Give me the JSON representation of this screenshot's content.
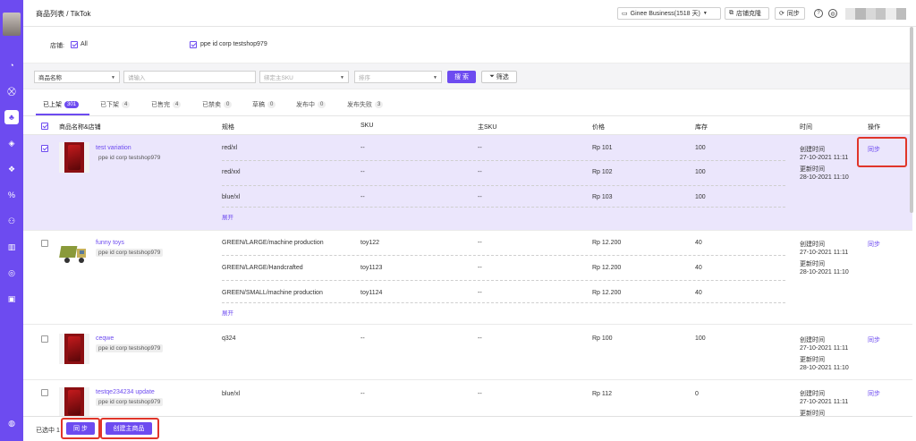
{
  "header": {
    "breadcrumb": "商品列表 / TikTok",
    "plan_label": "Ginee Business(1518 天)",
    "clone_label": "店铺克隆",
    "sync_label": "同步"
  },
  "shop_filter": {
    "label": "店铺:",
    "all_label": "All",
    "shop_name": "ppe id corp testshop979"
  },
  "search": {
    "field_select": "商品名称",
    "input_placeholder": "请输入",
    "bind_sku_placeholder": "绑定主SKU",
    "sort_placeholder": "排序",
    "search_button": "搜 索",
    "filter_button": "筛选"
  },
  "tabs": [
    {
      "label": "已上架",
      "count": "301"
    },
    {
      "label": "已下架",
      "count": "4"
    },
    {
      "label": "已售完",
      "count": "4"
    },
    {
      "label": "已禁卖",
      "count": "0"
    },
    {
      "label": "草稿",
      "count": "0"
    },
    {
      "label": "发布中",
      "count": "0"
    },
    {
      "label": "发布失败",
      "count": "3"
    }
  ],
  "table": {
    "headers": [
      "商品名称&店铺",
      "规格",
      "SKU",
      "主SKU",
      "价格",
      "库存",
      "时间",
      "操作"
    ],
    "expand_label": "展开",
    "sync_label": "同步",
    "created_label": "创建时间",
    "updated_label": "更新时间",
    "rows": [
      {
        "name": "test variation",
        "shop": "ppe id corp testshop979",
        "created": "27-10-2021 11:11",
        "updated": "28-10-2021 11:10",
        "variants": [
          {
            "spec": "red/xl",
            "sku": "--",
            "master_sku": "--",
            "price": "Rp 101",
            "stock": "100"
          },
          {
            "spec": "red/xxl",
            "sku": "--",
            "master_sku": "--",
            "price": "Rp 102",
            "stock": "100"
          },
          {
            "spec": "blue/xl",
            "sku": "--",
            "master_sku": "--",
            "price": "Rp 103",
            "stock": "100"
          }
        ]
      },
      {
        "name": "funny toys",
        "shop": "ppe id corp testshop979",
        "created": "27-10-2021 11:11",
        "updated": "28-10-2021 11:10",
        "variants": [
          {
            "spec": "GREEN/LARGE/machine production",
            "sku": "toy122",
            "master_sku": "--",
            "price": "Rp 12.200",
            "stock": "40"
          },
          {
            "spec": "GREEN/LARGE/Handcrafted",
            "sku": "toy1123",
            "master_sku": "--",
            "price": "Rp 12.200",
            "stock": "40"
          },
          {
            "spec": "GREEN/SMALL/machine production",
            "sku": "toy1124",
            "master_sku": "--",
            "price": "Rp 12.200",
            "stock": "40"
          }
        ]
      },
      {
        "name": "ceqwe",
        "shop": "ppe id corp testshop979",
        "created": "27-10-2021 11:11",
        "updated": "28-10-2021 11:10",
        "variants": [
          {
            "spec": "q324",
            "sku": "--",
            "master_sku": "--",
            "price": "Rp 100",
            "stock": "100"
          }
        ]
      },
      {
        "name": "testqe234234 update",
        "shop": "ppe id corp testshop979",
        "created": "27-10-2021 11:11",
        "updated": "",
        "variants": [
          {
            "spec": "blue/xl",
            "sku": "--",
            "master_sku": "--",
            "price": "Rp 112",
            "stock": "0"
          }
        ]
      }
    ]
  },
  "bottom": {
    "selected_label": "已选中 1",
    "sync_button": "同 步",
    "create_master_button": "创建主商品"
  },
  "colors": {
    "accent": "#6d4bf0",
    "highlight_row": "#ebe6fc",
    "annotation_red": "#e0352a"
  }
}
